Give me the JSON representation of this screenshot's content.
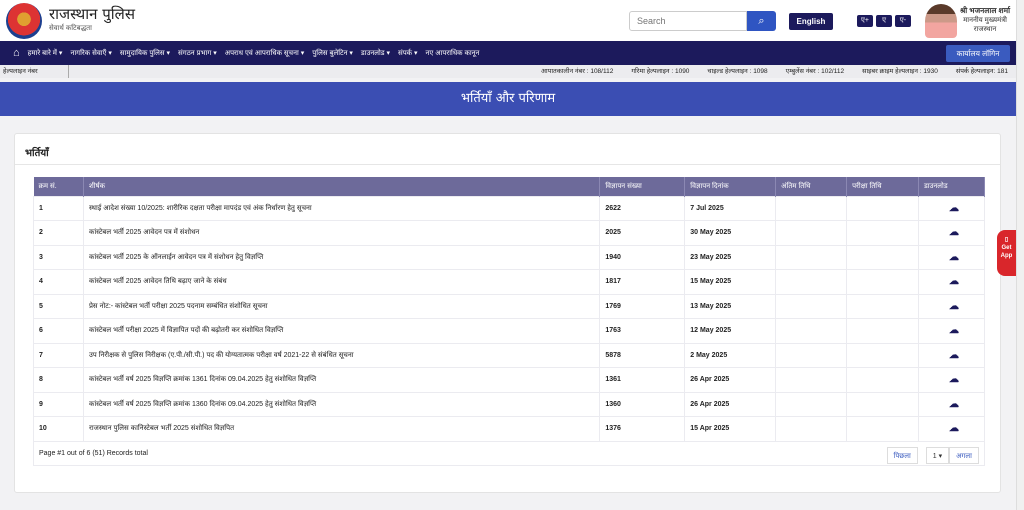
{
  "header": {
    "brand": "राजस्थान पुलिस",
    "tagline": "सेवार्थ कटिबद्धता",
    "search_placeholder": "Search",
    "language_button": "English",
    "font_sizes": [
      "ए+",
      "ए",
      "ए-"
    ],
    "cm_name": "श्री भजनलाल शर्मा",
    "cm_title": "माननीय मुख्यमंत्री",
    "cm_state": "राजस्थान"
  },
  "nav": {
    "items": [
      "हमारे बारे में ▾",
      "नागरिक सेवाएँ ▾",
      "सामुदायिक पुलिस ▾",
      "संगठन प्रभाग ▾",
      "अपराध एवं आपराधिक सूचना ▾",
      "पुलिस बुलेटिन ▾",
      "डाउनलोड ▾",
      "संपर्क ▾",
      "नए आपराधिक कानून"
    ],
    "login": "कार्यालय लॉगिन"
  },
  "helpline": {
    "label": "हेल्पलाइन नंबर",
    "numbers": [
      "आपातकालीन नंबर : 108/112",
      "गरिमा हेल्पलाइन : 1090",
      "चाइल्ड हेल्पलाइन : 1098",
      "एम्बुलेंस नंबर : 102/112",
      "साइबर क्राइम हेल्पलाइन : 1930",
      "संपर्क हेल्पलाइन: 181"
    ]
  },
  "banner": {
    "title": "भर्तियाँ और परिणाम"
  },
  "card": {
    "title": "भर्तियाँ"
  },
  "table": {
    "headers": [
      "क्रम सं.",
      "शीर्षक",
      "विज्ञापन संख्या",
      "विज्ञापन दिनांक",
      "अंतिम तिथि",
      "परीक्षा तिथि",
      "डाउनलोड"
    ],
    "rows": [
      [
        "1",
        "स्थाई आदेश संख्या 10/2025: शारीरिक दक्षता परीक्षा मापदंड एवं अंक निर्धारण हेतु सूचना",
        "2622",
        "7 Jul 2025"
      ],
      [
        "2",
        "कांस्टेबल भर्ती 2025 आवेदन पत्र में संशोधन",
        "2025",
        "30 May 2025"
      ],
      [
        "3",
        "कांस्टेबल भर्ती 2025 के ऑनलाईन आवेदन पत्र में संशोधन हेतु विज्ञप्ति",
        "1940",
        "23 May 2025"
      ],
      [
        "4",
        "कांस्टेबल भर्ती 2025 आवेदन तिथि बढ़ाए जाने के संबंध",
        "1817",
        "15 May 2025"
      ],
      [
        "5",
        "प्रेस नोट:- कांस्टेबल भर्ती परीक्षा 2025 पदनाम सम्बंधित संशोधित सूचना",
        "1769",
        "13 May 2025"
      ],
      [
        "6",
        "कांस्टेबल भर्ती परीक्षा 2025 में विज्ञापित पदों की बढ़ोतरी कर संशोधित विज्ञप्ति",
        "1763",
        "12 May 2025"
      ],
      [
        "7",
        "उप निरीक्षक से पुलिस निरीक्षक (ए.पी./सी.पी.) पद की योग्यतात्मक परीक्षा वर्ष 2021-22 से संबंधित सूचना",
        "5878",
        "2 May 2025"
      ],
      [
        "8",
        "कांस्टेबल भर्ती वर्ष 2025 विज्ञप्ति क्रमांक 1361 दिनांक 09.04.2025 हेतु संशोधित विज्ञप्ति",
        "1361",
        "26 Apr 2025"
      ],
      [
        "9",
        "कांस्टेबल भर्ती वर्ष 2025 विज्ञप्ति क्रमांक 1360 दिनांक 09.04.2025 हेतु संशोधित विज्ञप्ति",
        "1360",
        "26 Apr 2025"
      ],
      [
        "10",
        "राजस्थान पुलिस कानिस्टेबल भर्ती 2025 संशोधित विज्ञपित",
        "1376",
        "15 Apr 2025"
      ]
    ],
    "page_info": "Page #1 out of 6 (51) Records total"
  },
  "pagination": {
    "prev": "पिछला",
    "page": "1 ▾",
    "next": "अगला"
  },
  "get_app": [
    "Get",
    "App"
  ]
}
